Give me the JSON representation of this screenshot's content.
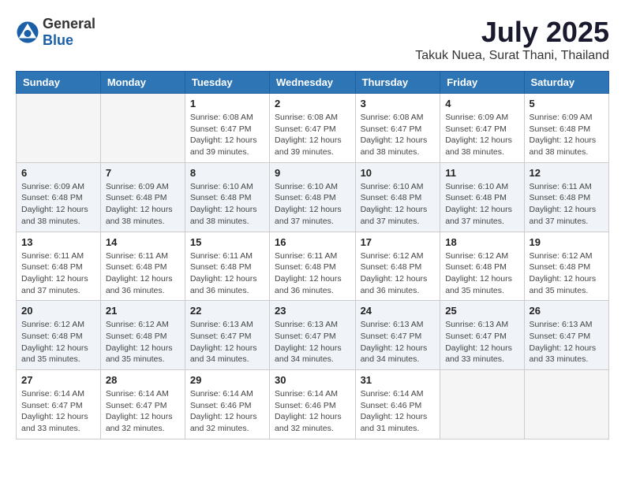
{
  "header": {
    "logo_general": "General",
    "logo_blue": "Blue",
    "month": "July 2025",
    "location": "Takuk Nuea, Surat Thani, Thailand"
  },
  "days_of_week": [
    "Sunday",
    "Monday",
    "Tuesday",
    "Wednesday",
    "Thursday",
    "Friday",
    "Saturday"
  ],
  "weeks": [
    {
      "shaded": false,
      "days": [
        {
          "num": "",
          "info": ""
        },
        {
          "num": "",
          "info": ""
        },
        {
          "num": "1",
          "info": "Sunrise: 6:08 AM\nSunset: 6:47 PM\nDaylight: 12 hours and 39 minutes."
        },
        {
          "num": "2",
          "info": "Sunrise: 6:08 AM\nSunset: 6:47 PM\nDaylight: 12 hours and 39 minutes."
        },
        {
          "num": "3",
          "info": "Sunrise: 6:08 AM\nSunset: 6:47 PM\nDaylight: 12 hours and 38 minutes."
        },
        {
          "num": "4",
          "info": "Sunrise: 6:09 AM\nSunset: 6:47 PM\nDaylight: 12 hours and 38 minutes."
        },
        {
          "num": "5",
          "info": "Sunrise: 6:09 AM\nSunset: 6:48 PM\nDaylight: 12 hours and 38 minutes."
        }
      ]
    },
    {
      "shaded": true,
      "days": [
        {
          "num": "6",
          "info": "Sunrise: 6:09 AM\nSunset: 6:48 PM\nDaylight: 12 hours and 38 minutes."
        },
        {
          "num": "7",
          "info": "Sunrise: 6:09 AM\nSunset: 6:48 PM\nDaylight: 12 hours and 38 minutes."
        },
        {
          "num": "8",
          "info": "Sunrise: 6:10 AM\nSunset: 6:48 PM\nDaylight: 12 hours and 38 minutes."
        },
        {
          "num": "9",
          "info": "Sunrise: 6:10 AM\nSunset: 6:48 PM\nDaylight: 12 hours and 37 minutes."
        },
        {
          "num": "10",
          "info": "Sunrise: 6:10 AM\nSunset: 6:48 PM\nDaylight: 12 hours and 37 minutes."
        },
        {
          "num": "11",
          "info": "Sunrise: 6:10 AM\nSunset: 6:48 PM\nDaylight: 12 hours and 37 minutes."
        },
        {
          "num": "12",
          "info": "Sunrise: 6:11 AM\nSunset: 6:48 PM\nDaylight: 12 hours and 37 minutes."
        }
      ]
    },
    {
      "shaded": false,
      "days": [
        {
          "num": "13",
          "info": "Sunrise: 6:11 AM\nSunset: 6:48 PM\nDaylight: 12 hours and 37 minutes."
        },
        {
          "num": "14",
          "info": "Sunrise: 6:11 AM\nSunset: 6:48 PM\nDaylight: 12 hours and 36 minutes."
        },
        {
          "num": "15",
          "info": "Sunrise: 6:11 AM\nSunset: 6:48 PM\nDaylight: 12 hours and 36 minutes."
        },
        {
          "num": "16",
          "info": "Sunrise: 6:11 AM\nSunset: 6:48 PM\nDaylight: 12 hours and 36 minutes."
        },
        {
          "num": "17",
          "info": "Sunrise: 6:12 AM\nSunset: 6:48 PM\nDaylight: 12 hours and 36 minutes."
        },
        {
          "num": "18",
          "info": "Sunrise: 6:12 AM\nSunset: 6:48 PM\nDaylight: 12 hours and 35 minutes."
        },
        {
          "num": "19",
          "info": "Sunrise: 6:12 AM\nSunset: 6:48 PM\nDaylight: 12 hours and 35 minutes."
        }
      ]
    },
    {
      "shaded": true,
      "days": [
        {
          "num": "20",
          "info": "Sunrise: 6:12 AM\nSunset: 6:48 PM\nDaylight: 12 hours and 35 minutes."
        },
        {
          "num": "21",
          "info": "Sunrise: 6:12 AM\nSunset: 6:48 PM\nDaylight: 12 hours and 35 minutes."
        },
        {
          "num": "22",
          "info": "Sunrise: 6:13 AM\nSunset: 6:47 PM\nDaylight: 12 hours and 34 minutes."
        },
        {
          "num": "23",
          "info": "Sunrise: 6:13 AM\nSunset: 6:47 PM\nDaylight: 12 hours and 34 minutes."
        },
        {
          "num": "24",
          "info": "Sunrise: 6:13 AM\nSunset: 6:47 PM\nDaylight: 12 hours and 34 minutes."
        },
        {
          "num": "25",
          "info": "Sunrise: 6:13 AM\nSunset: 6:47 PM\nDaylight: 12 hours and 33 minutes."
        },
        {
          "num": "26",
          "info": "Sunrise: 6:13 AM\nSunset: 6:47 PM\nDaylight: 12 hours and 33 minutes."
        }
      ]
    },
    {
      "shaded": false,
      "days": [
        {
          "num": "27",
          "info": "Sunrise: 6:14 AM\nSunset: 6:47 PM\nDaylight: 12 hours and 33 minutes."
        },
        {
          "num": "28",
          "info": "Sunrise: 6:14 AM\nSunset: 6:47 PM\nDaylight: 12 hours and 32 minutes."
        },
        {
          "num": "29",
          "info": "Sunrise: 6:14 AM\nSunset: 6:46 PM\nDaylight: 12 hours and 32 minutes."
        },
        {
          "num": "30",
          "info": "Sunrise: 6:14 AM\nSunset: 6:46 PM\nDaylight: 12 hours and 32 minutes."
        },
        {
          "num": "31",
          "info": "Sunrise: 6:14 AM\nSunset: 6:46 PM\nDaylight: 12 hours and 31 minutes."
        },
        {
          "num": "",
          "info": ""
        },
        {
          "num": "",
          "info": ""
        }
      ]
    }
  ]
}
